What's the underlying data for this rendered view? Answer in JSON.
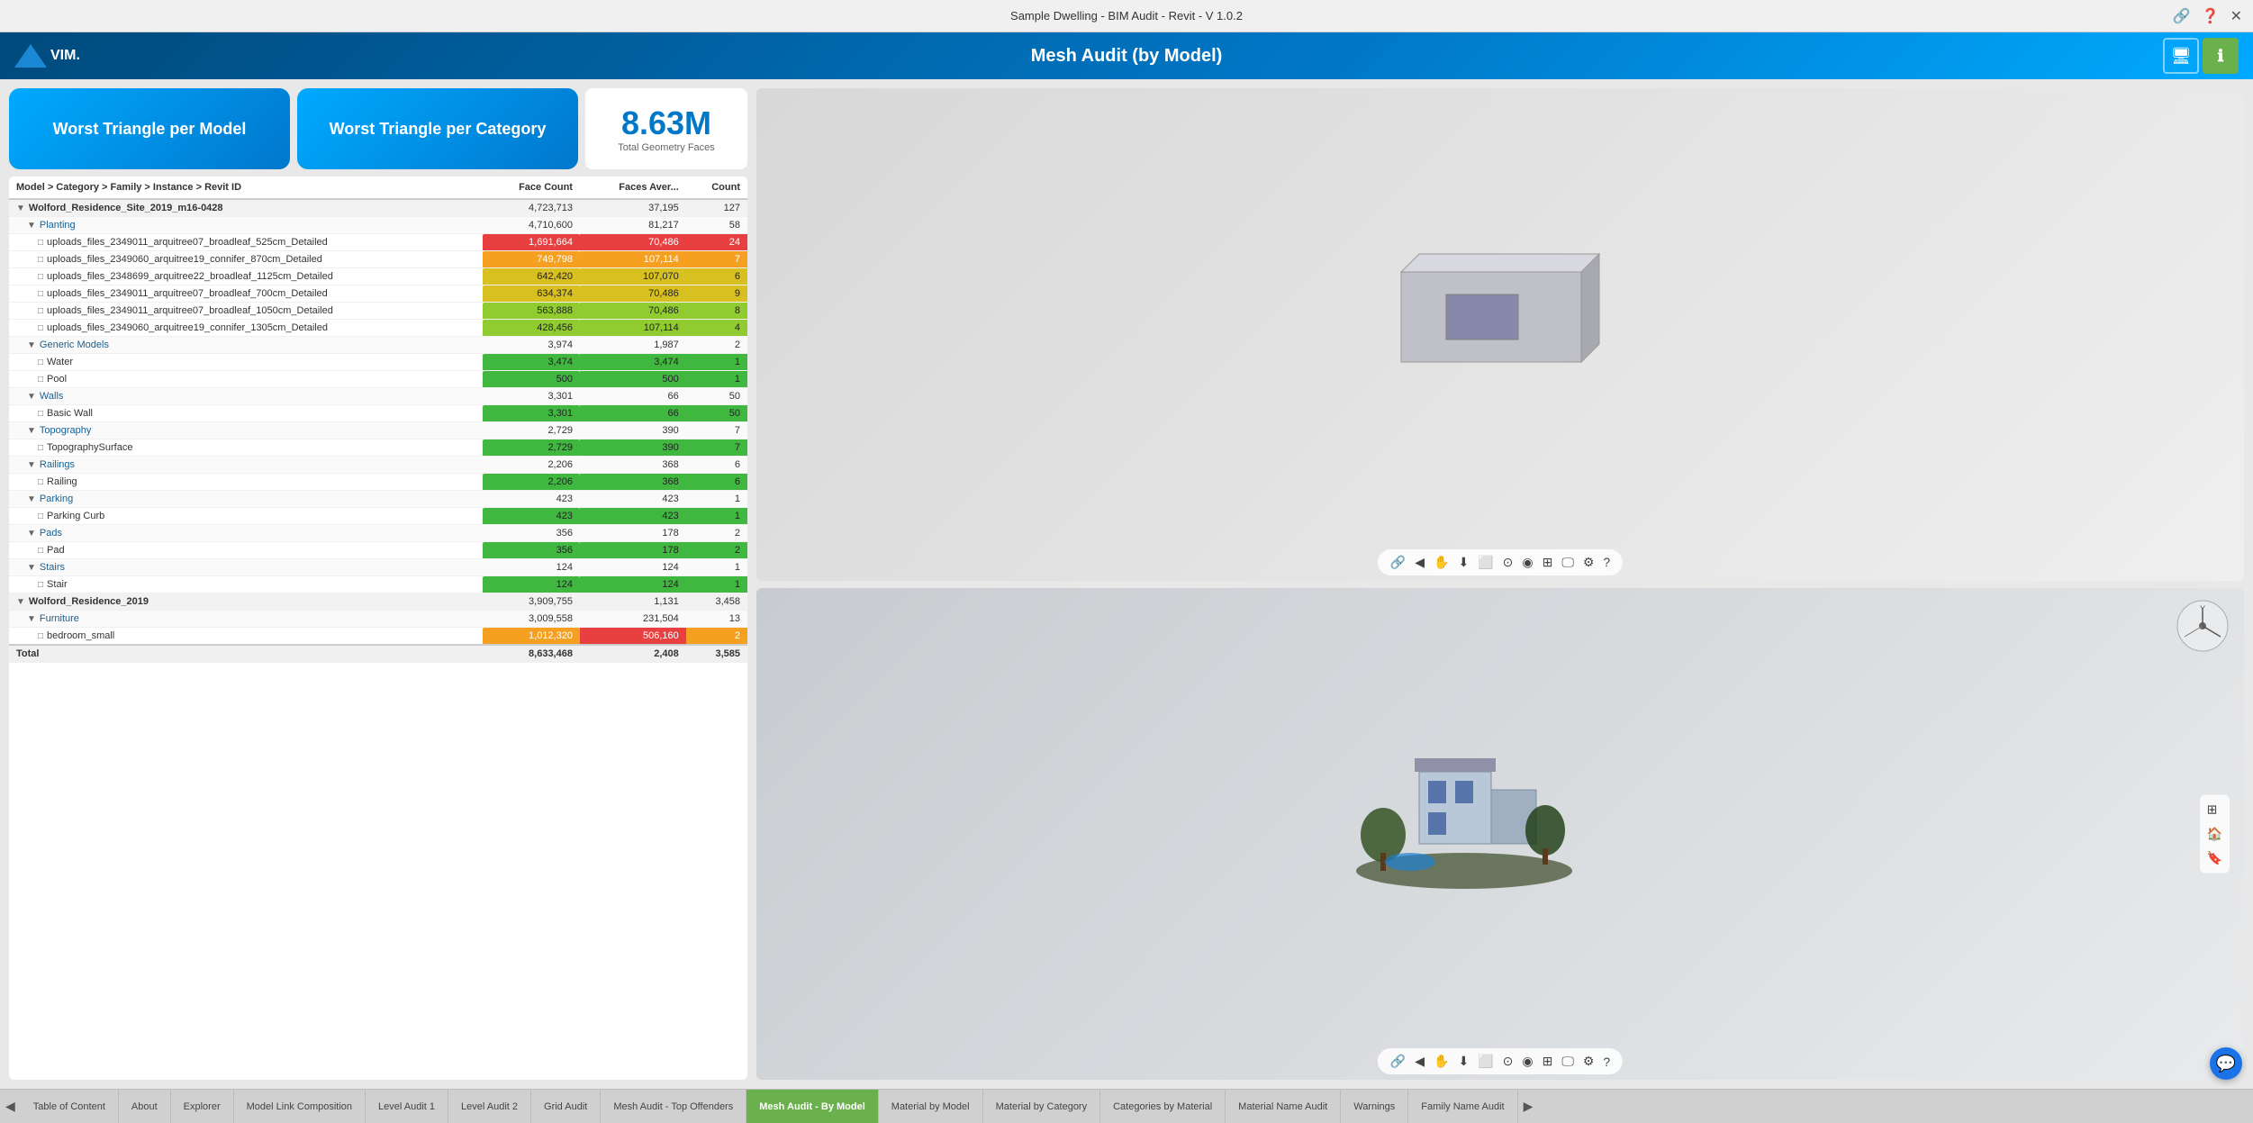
{
  "titleBar": {
    "title": "Sample Dwelling - BIM Audit - Revit - V 1.0.2"
  },
  "header": {
    "logo": "VIM.",
    "title": "Mesh Audit (by Model)",
    "displayBtn": "🖥",
    "infoBtn": "ℹ"
  },
  "cards": {
    "worstTriangleModel": "Worst Triangle per Model",
    "worstTriangleCategory": "Worst Triangle per Category",
    "totalFaces": "8.63M",
    "totalFacesLabel": "Total Geometry Faces"
  },
  "tableHeader": {
    "col1": "Model > Category > Family > Instance > Revit ID",
    "col2": "Face Count",
    "col3": "Faces Aver...",
    "col4": "Count"
  },
  "tableRows": [
    {
      "level": 0,
      "indent": "indent1",
      "icon": "▼",
      "name": "Wolford_Residence_Site_2019_m16-0428",
      "faceCount": "4,723,713",
      "facesAver": "37,195",
      "count": "127",
      "barColor": "",
      "barWidth": 0,
      "highlight": ""
    },
    {
      "level": 1,
      "indent": "indent2",
      "icon": "▼",
      "name": "Planting",
      "faceCount": "4,710,600",
      "facesAver": "81,217",
      "count": "58",
      "barColor": "",
      "barWidth": 0,
      "highlight": ""
    },
    {
      "level": 2,
      "indent": "indent3",
      "icon": "□",
      "name": "uploads_files_2349011_arquitree07_broadleaf_525cm_Detailed",
      "faceCount": "1,691,664",
      "facesAver": "70,486",
      "count": "24",
      "barColor": "bar-red",
      "barWidth": 100,
      "highlight": "highlight-red",
      "facesHighlight": ""
    },
    {
      "level": 2,
      "indent": "indent3",
      "icon": "□",
      "name": "uploads_files_2349060_arquitree19_connifer_870cm_Detailed",
      "faceCount": "749,798",
      "facesAver": "107,114",
      "count": "7",
      "barColor": "bar-orange",
      "barWidth": 44,
      "highlight": "",
      "facesHighlight": ""
    },
    {
      "level": 2,
      "indent": "indent3",
      "icon": "□",
      "name": "uploads_files_2348699_arquitree22_broadleaf_1125cm_Detailed",
      "faceCount": "642,420",
      "facesAver": "107,070",
      "count": "6",
      "barColor": "bar-yellow",
      "barWidth": 38,
      "highlight": "",
      "facesHighlight": ""
    },
    {
      "level": 2,
      "indent": "indent3",
      "icon": "□",
      "name": "uploads_files_2349011_arquitree07_broadleaf_700cm_Detailed",
      "faceCount": "634,374",
      "facesAver": "70,486",
      "count": "9",
      "barColor": "bar-yellow",
      "barWidth": 37,
      "highlight": "",
      "facesHighlight": ""
    },
    {
      "level": 2,
      "indent": "indent3",
      "icon": "□",
      "name": "uploads_files_2349011_arquitree07_broadleaf_1050cm_Detailed",
      "faceCount": "563,888",
      "facesAver": "70,486",
      "count": "8",
      "barColor": "bar-lime",
      "barWidth": 33,
      "highlight": "",
      "facesHighlight": ""
    },
    {
      "level": 2,
      "indent": "indent3",
      "icon": "□",
      "name": "uploads_files_2349060_arquitree19_connifer_1305cm_Detailed",
      "faceCount": "428,456",
      "facesAver": "107,114",
      "count": "4",
      "barColor": "bar-lime",
      "barWidth": 25,
      "highlight": "",
      "facesHighlight": ""
    },
    {
      "level": 1,
      "indent": "indent2",
      "icon": "▼",
      "name": "Generic Models",
      "faceCount": "3,974",
      "facesAver": "1,987",
      "count": "2",
      "barColor": "",
      "barWidth": 0,
      "highlight": ""
    },
    {
      "level": 2,
      "indent": "indent3",
      "icon": "□",
      "name": "Water",
      "faceCount": "3,474",
      "facesAver": "3,474",
      "count": "1",
      "barColor": "bar-green",
      "barWidth": 0,
      "highlight": "",
      "facesHighlight": ""
    },
    {
      "level": 2,
      "indent": "indent3",
      "icon": "□",
      "name": "Pool",
      "faceCount": "500",
      "facesAver": "500",
      "count": "1",
      "barColor": "bar-green",
      "barWidth": 0,
      "highlight": "",
      "facesHighlight": ""
    },
    {
      "level": 1,
      "indent": "indent2",
      "icon": "▼",
      "name": "Walls",
      "faceCount": "3,301",
      "facesAver": "66",
      "count": "50",
      "barColor": "",
      "barWidth": 0,
      "highlight": ""
    },
    {
      "level": 2,
      "indent": "indent3",
      "icon": "□",
      "name": "Basic Wall",
      "faceCount": "3,301",
      "facesAver": "66",
      "count": "50",
      "barColor": "bar-green",
      "barWidth": 0,
      "highlight": "",
      "facesHighlight": ""
    },
    {
      "level": 1,
      "indent": "indent2",
      "icon": "▼",
      "name": "Topography",
      "faceCount": "2,729",
      "facesAver": "390",
      "count": "7",
      "barColor": "",
      "barWidth": 0,
      "highlight": ""
    },
    {
      "level": 2,
      "indent": "indent3",
      "icon": "□",
      "name": "TopographySurface",
      "faceCount": "2,729",
      "facesAver": "390",
      "count": "7",
      "barColor": "bar-green",
      "barWidth": 0,
      "highlight": "",
      "facesHighlight": ""
    },
    {
      "level": 1,
      "indent": "indent2",
      "icon": "▼",
      "name": "Railings",
      "faceCount": "2,206",
      "facesAver": "368",
      "count": "6",
      "barColor": "",
      "barWidth": 0,
      "highlight": ""
    },
    {
      "level": 2,
      "indent": "indent3",
      "icon": "□",
      "name": "Railing",
      "faceCount": "2,206",
      "facesAver": "368",
      "count": "6",
      "barColor": "bar-green",
      "barWidth": 0,
      "highlight": "",
      "facesHighlight": ""
    },
    {
      "level": 1,
      "indent": "indent2",
      "icon": "▼",
      "name": "Parking",
      "faceCount": "423",
      "facesAver": "423",
      "count": "1",
      "barColor": "",
      "barWidth": 0,
      "highlight": ""
    },
    {
      "level": 2,
      "indent": "indent3",
      "icon": "□",
      "name": "Parking Curb",
      "faceCount": "423",
      "facesAver": "423",
      "count": "1",
      "barColor": "bar-green",
      "barWidth": 0,
      "highlight": "",
      "facesHighlight": ""
    },
    {
      "level": 1,
      "indent": "indent2",
      "icon": "▼",
      "name": "Pads",
      "faceCount": "356",
      "facesAver": "178",
      "count": "2",
      "barColor": "",
      "barWidth": 0,
      "highlight": ""
    },
    {
      "level": 2,
      "indent": "indent3",
      "icon": "□",
      "name": "Pad",
      "faceCount": "356",
      "facesAver": "178",
      "count": "2",
      "barColor": "bar-green",
      "barWidth": 0,
      "highlight": "",
      "facesHighlight": ""
    },
    {
      "level": 1,
      "indent": "indent2",
      "icon": "▼",
      "name": "Stairs",
      "faceCount": "124",
      "facesAver": "124",
      "count": "1",
      "barColor": "",
      "barWidth": 0,
      "highlight": ""
    },
    {
      "level": 2,
      "indent": "indent3",
      "icon": "□",
      "name": "Stair",
      "faceCount": "124",
      "facesAver": "124",
      "count": "1",
      "barColor": "bar-green",
      "barWidth": 0,
      "highlight": "",
      "facesHighlight": ""
    },
    {
      "level": 0,
      "indent": "indent1",
      "icon": "▼",
      "name": "Wolford_Residence_2019",
      "faceCount": "3,909,755",
      "facesAver": "1,131",
      "count": "3,458",
      "barColor": "",
      "barWidth": 0,
      "highlight": ""
    },
    {
      "level": 1,
      "indent": "indent2",
      "icon": "▼",
      "name": "Furniture",
      "faceCount": "3,009,558",
      "facesAver": "231,504",
      "count": "13",
      "barColor": "",
      "barWidth": 0,
      "highlight": ""
    },
    {
      "level": 2,
      "indent": "indent3",
      "icon": "□",
      "name": "bedroom_small",
      "faceCount": "1,012,320",
      "facesAver": "506,160",
      "count": "2",
      "barColor": "bar-orange",
      "barWidth": 60,
      "highlight": "highlight-orange",
      "facesHighlight": "highlight-red"
    }
  ],
  "tableTotalRow": {
    "label": "Total",
    "faceCount": "8,633,468",
    "facesAver": "2,408",
    "count": "3,585"
  },
  "tabs": [
    {
      "id": "table-of-content",
      "label": "Table of Content",
      "active": false
    },
    {
      "id": "about",
      "label": "About",
      "active": false
    },
    {
      "id": "explorer",
      "label": "Explorer",
      "active": false
    },
    {
      "id": "model-link-composition",
      "label": "Model Link Composition",
      "active": false
    },
    {
      "id": "level-audit-1",
      "label": "Level Audit 1",
      "active": false
    },
    {
      "id": "level-audit-2",
      "label": "Level Audit 2",
      "active": false
    },
    {
      "id": "grid-audit",
      "label": "Grid Audit",
      "active": false
    },
    {
      "id": "mesh-audit-top-offenders",
      "label": "Mesh Audit - Top Offenders",
      "active": false
    },
    {
      "id": "mesh-audit-by-model",
      "label": "Mesh Audit - By Model",
      "active": true
    },
    {
      "id": "material-by-model",
      "label": "Material by Model",
      "active": false
    },
    {
      "id": "material-by-category",
      "label": "Material by Category",
      "active": false
    },
    {
      "id": "categories-by-material",
      "label": "Categories by Material",
      "active": false
    },
    {
      "id": "material-name-audit",
      "label": "Material Name Audit",
      "active": false
    },
    {
      "id": "warnings",
      "label": "Warnings",
      "active": false
    },
    {
      "id": "family-name-audit",
      "label": "Family Name Audit",
      "active": false
    }
  ]
}
